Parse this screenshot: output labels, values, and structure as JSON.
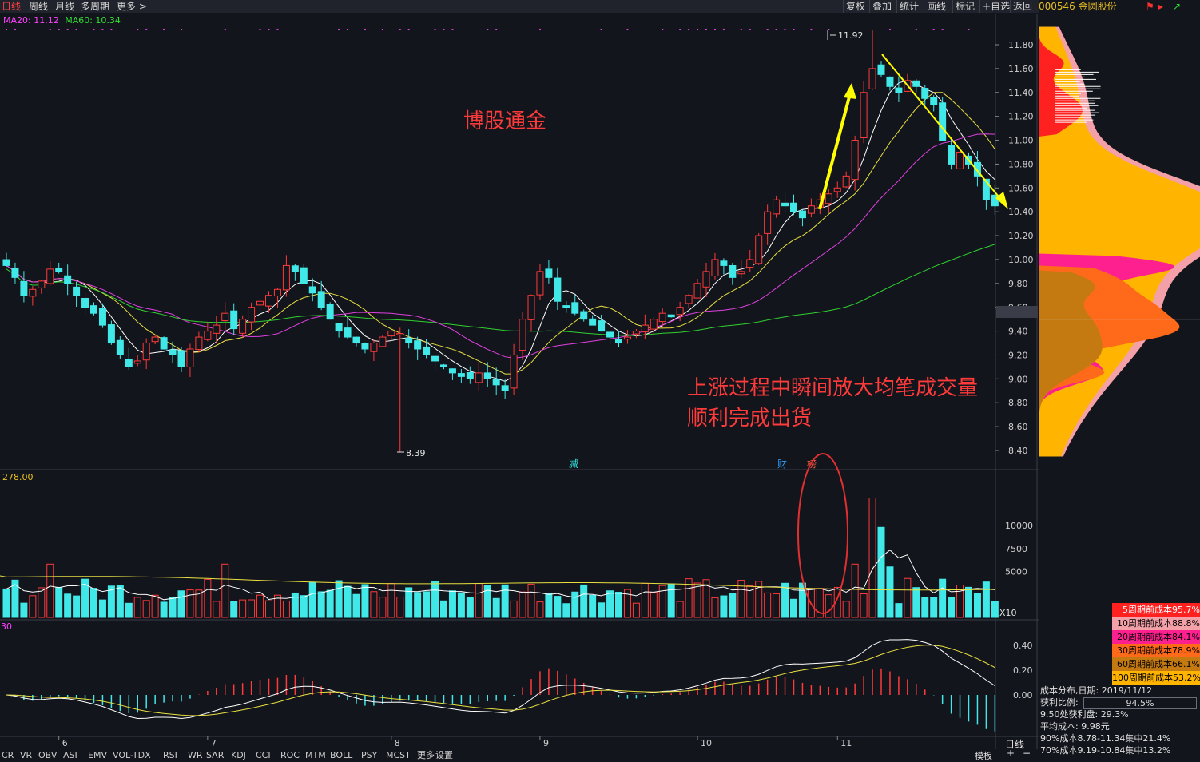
{
  "header": {
    "tabs": [
      "日线",
      "周线",
      "月线",
      "多周期",
      "更多 >"
    ],
    "active_tab": "日线",
    "right_buttons": [
      "复权",
      "叠加",
      "统计",
      "画线",
      "标记",
      "+自选",
      "返回"
    ]
  },
  "stock": {
    "code": "000546",
    "name": "金圆股份"
  },
  "ma_legend": {
    "ma20": "MA20: 11.12",
    "ma60": "MA60: 10.34"
  },
  "annotations": {
    "title_text": "博股通金",
    "note_line1": "上涨过程中瞬间放大均笔成交量",
    "note_line2": "顺利完成出货",
    "high_label": "11.92",
    "low_label": "8.39",
    "event_jian": "减",
    "event_cai": "财",
    "event_bang": "榜",
    "current_price_tag": "9.50"
  },
  "volume_panel": {
    "top_value": "278.00",
    "unit": "X10"
  },
  "macd_panel": {
    "top_value": "30"
  },
  "bottom": {
    "indicators": [
      "CR",
      "VR",
      "OBV",
      "ASI",
      "EMV",
      "VOL-TDX",
      "RSI",
      "WR",
      "SAR",
      "KDJ",
      "CCI",
      "ROC",
      "MTM",
      "BOLL",
      "PSY",
      "MCST",
      "更多",
      "设置"
    ],
    "period_button": "日线",
    "mode_button": "模板"
  },
  "cost_legend": [
    {
      "label": "5周期前成本95.7%",
      "color": "#ff2020"
    },
    {
      "label": "10周期前成本88.8%",
      "color": "#f4a0a8"
    },
    {
      "label": "20周期前成本84.1%",
      "color": "#ff2090"
    },
    {
      "label": "30周期前成本78.9%",
      "color": "#ff6a1a"
    },
    {
      "label": "60周期前成本66.1%",
      "color": "#c47a10"
    },
    {
      "label": "100周期前成本53.2%",
      "color": "#ffb400"
    }
  ],
  "cost_info": {
    "date_label": "成本分布,日期: 2019/11/12",
    "profit_label": "获利比例:",
    "profit_value": "94.5%",
    "at_price_profit": "9.50处获利盘: 29.3%",
    "avg_cost": "平均成本: 9.98元",
    "range_90": "90%成本8.78-11.34集中21.4%",
    "range_70": "70%成本9.19-10.84集中13.2%"
  },
  "chart_data": [
    {
      "type": "candlestick",
      "title": "",
      "y_ticks": [
        11.8,
        11.6,
        11.4,
        11.2,
        11.0,
        10.8,
        10.6,
        10.4,
        10.2,
        10.0,
        9.8,
        9.6,
        9.4,
        9.2,
        9.0,
        8.8,
        8.6,
        8.4
      ],
      "ylim": [
        8.3,
        12.0
      ],
      "x_ticks": [
        "6",
        "7",
        "8",
        "9",
        "10",
        "11"
      ],
      "high": 11.92,
      "low": 8.39,
      "series": [
        {
          "name": "MA20",
          "value": 11.12
        },
        {
          "name": "MA60",
          "value": 10.34
        }
      ],
      "closes": [
        9.95,
        9.85,
        9.7,
        9.75,
        9.82,
        9.92,
        9.9,
        9.8,
        9.7,
        9.6,
        9.55,
        9.45,
        9.3,
        9.2,
        9.1,
        9.15,
        9.3,
        9.35,
        9.25,
        9.2,
        9.1,
        9.25,
        9.35,
        9.4,
        9.45,
        9.55,
        9.42,
        9.5,
        9.6,
        9.65,
        9.7,
        9.75,
        9.95,
        9.9,
        9.8,
        9.72,
        9.6,
        9.5,
        9.4,
        9.35,
        9.3,
        9.25,
        9.3,
        9.35,
        9.4,
        9.38,
        9.3,
        9.25,
        9.2,
        9.15,
        9.1,
        9.05,
        9.02,
        9.0,
        9.05,
        9.0,
        8.95,
        8.9,
        9.2,
        9.5,
        9.7,
        9.9,
        9.85,
        9.65,
        9.6,
        9.55,
        9.5,
        9.45,
        9.4,
        9.35,
        9.3,
        9.35,
        9.4,
        9.45,
        9.5,
        9.55,
        9.52,
        9.6,
        9.7,
        9.8,
        9.9,
        10.0,
        9.95,
        9.85,
        9.9,
        10.0,
        10.2,
        10.4,
        10.5,
        10.45,
        10.4,
        10.35,
        10.45,
        10.5,
        10.55,
        10.6,
        10.7,
        11.0,
        11.4,
        11.6,
        11.55,
        11.45,
        11.4,
        11.5,
        11.45,
        11.35,
        11.3,
        11.0,
        10.8,
        10.9,
        10.8,
        10.7,
        10.5,
        10.45
      ]
    },
    {
      "type": "bar",
      "title": "",
      "y_ticks": [
        10000,
        7500,
        5000
      ],
      "unit": "X10",
      "volume_peak_approx": 12500
    },
    {
      "type": "line",
      "title": "",
      "y_ticks": [
        0.4,
        0.2,
        0.0
      ],
      "ylim": [
        -0.32,
        0.52
      ]
    }
  ]
}
